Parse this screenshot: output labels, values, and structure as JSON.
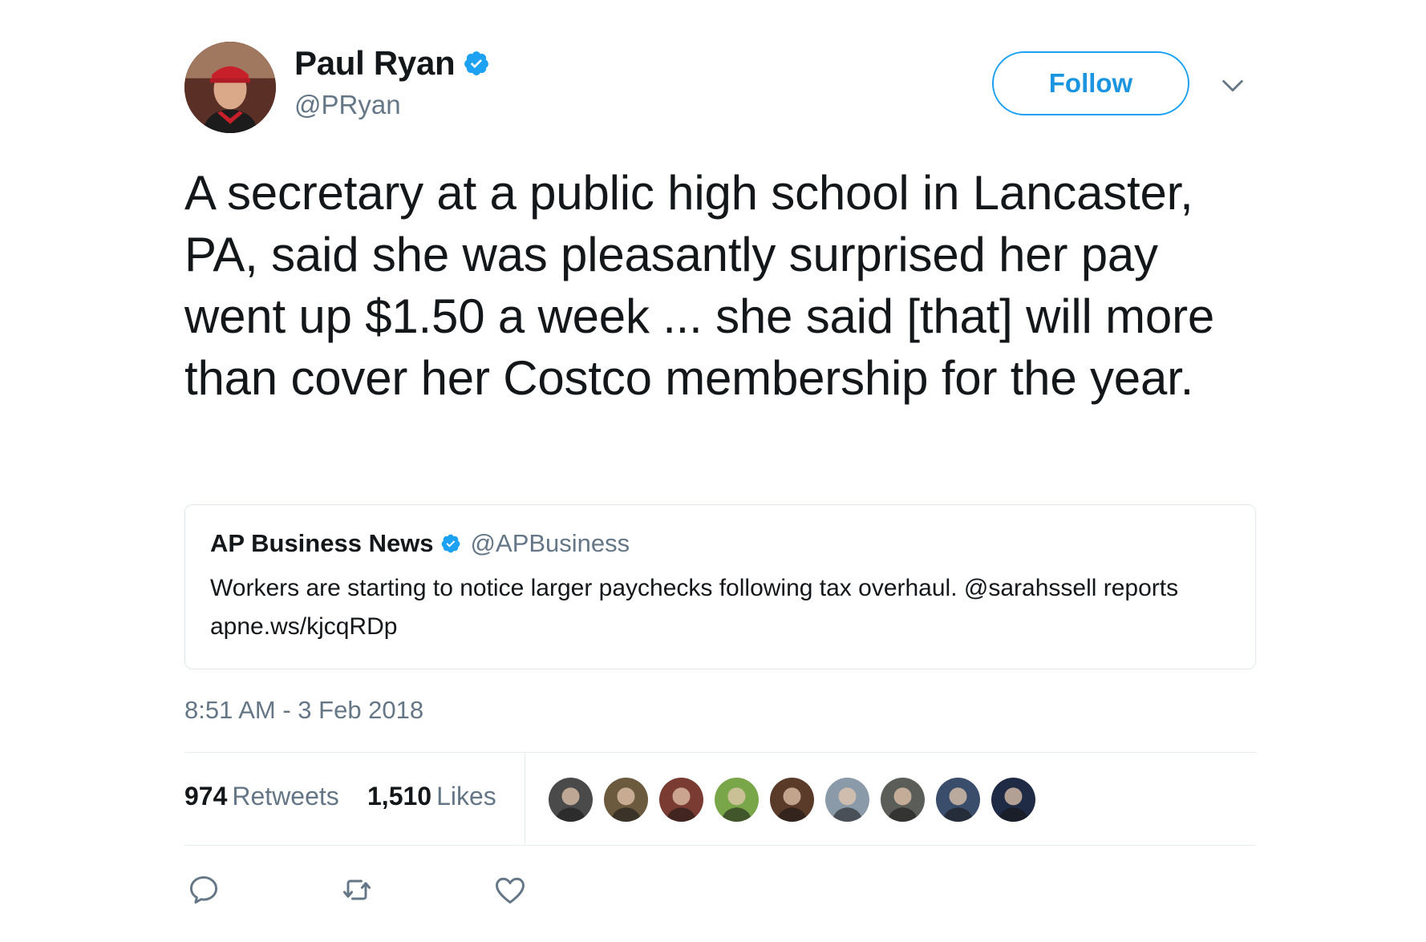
{
  "author": {
    "name": "Paul Ryan",
    "handle": "@PRyan",
    "verified": true
  },
  "header": {
    "follow_label": "Follow",
    "menu_icon": "chevron-down-icon"
  },
  "tweet": {
    "text": "A secretary at a public high school in Lancaster, PA, said she was pleasantly surprised her pay went up $1.50 a week ... she said [that] will more than cover her Costco membership for the year.",
    "timestamp": "8:51 AM - 3 Feb 2018"
  },
  "quote": {
    "name": "AP Business News",
    "handle": "@APBusiness",
    "verified": true,
    "text": "Workers are starting to notice larger paychecks following tax overhaul. @sarahssell reports apne.ws/kjcqRDp"
  },
  "stats": {
    "retweets_count": "974",
    "retweets_label": "Retweets",
    "likes_count": "1,510",
    "likes_label": "Likes"
  },
  "likers": [
    {
      "name": "liker-avatar-1",
      "color": "#4a4a4a"
    },
    {
      "name": "liker-avatar-2",
      "color": "#6b5a3e"
    },
    {
      "name": "liker-avatar-3",
      "color": "#7a3b32"
    },
    {
      "name": "liker-avatar-4",
      "color": "#7aa64a"
    },
    {
      "name": "liker-avatar-5",
      "color": "#5a3b2a"
    },
    {
      "name": "liker-avatar-6",
      "color": "#8a9aa8"
    },
    {
      "name": "liker-avatar-7",
      "color": "#5b5e58"
    },
    {
      "name": "liker-avatar-8",
      "color": "#3a4d6a"
    },
    {
      "name": "liker-avatar-9",
      "color": "#1f2a44"
    }
  ],
  "actions": {
    "reply_icon": "reply-icon",
    "retweet_icon": "retweet-icon",
    "like_icon": "heart-icon"
  },
  "colors": {
    "accent": "#1da1f2",
    "verified": "#1da1f2",
    "text_primary": "#14171a",
    "text_secondary": "#657786",
    "border": "#e1e8ed"
  }
}
